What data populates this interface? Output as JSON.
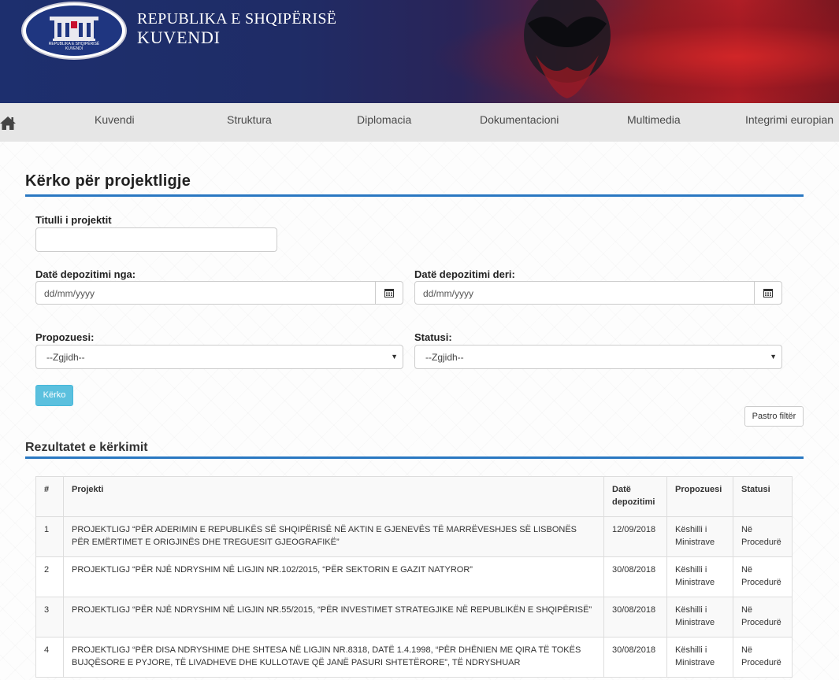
{
  "header": {
    "seal_text_line1": "REPUBLIKA E SHQIPËRISË",
    "seal_text_line2": "KUVENDI",
    "title_line1": "REPUBLIKA E SHQIPËRISË",
    "title_line2": "KUVENDI"
  },
  "nav": {
    "home_icon": "home-icon",
    "items": [
      "Kuvendi",
      "Struktura",
      "Diplomacia",
      "Dokumentacioni",
      "Multimedia",
      "Integrimi europian"
    ]
  },
  "page": {
    "title": "Kërko për projektligje"
  },
  "form": {
    "title_label": "Titulli i projektit",
    "title_value": "",
    "date_from_label": "Datë depozitimi nga:",
    "date_from_placeholder": "dd/mm/yyyy",
    "date_to_label": "Datë depozitimi deri:",
    "date_to_placeholder": "dd/mm/yyyy",
    "proposer_label": "Propozuesi:",
    "proposer_selected": "--Zgjidh--",
    "status_label": "Statusi:",
    "status_selected": "--Zgjidh--",
    "search_button": "Kërko",
    "clear_button": "Pastro filtër"
  },
  "results": {
    "title": "Rezultatet e kërkimit",
    "columns": [
      "#",
      "Projekti",
      "Datë depozitimi",
      "Propozuesi",
      "Statusi"
    ],
    "rows": [
      {
        "num": "1",
        "project": "PROJEKTLIGJ “PËR ADERIMIN E REPUBLIKËS SË SHQIPËRISË NË AKTIN E GJENEVËS TË MARRËVESHJES SË LISBONËS PËR EMËRTIMET E ORIGJINËS DHE TREGUESIT GJEOGRAFIKË”",
        "date": "12/09/2018",
        "proposer": "Këshilli i Ministrave",
        "status": "Në Procedurë"
      },
      {
        "num": "2",
        "project": "PROJEKTLIGJ “PËR NJË NDRYSHIM NË LIGJIN NR.102/2015, “PËR SEKTORIN E GAZIT NATYROR”",
        "date": "30/08/2018",
        "proposer": "Këshilli i Ministrave",
        "status": "Në Procedurë"
      },
      {
        "num": "3",
        "project": "PROJEKTLIGJ “PËR NJË NDRYSHIM NË LIGJIN NR.55/2015, “PËR INVESTIMET STRATEGJIKE NË REPUBLIKËN E SHQIPËRISË”",
        "date": "30/08/2018",
        "proposer": "Këshilli i Ministrave",
        "status": "Në Procedurë"
      },
      {
        "num": "4",
        "project": "PROJEKTLIGJ “PËR DISA NDRYSHIME DHE SHTESA NË LIGJIN NR.8318, DATË 1.4.1998, “PËR DHËNIEN ME QIRA TË TOKËS BUJQËSORE E PYJORE, TË LIVADHEVE DHE KULLOTAVE QË JANË PASURI SHTETËRORE”, TË NDRYSHUAR",
        "date": "30/08/2018",
        "proposer": "Këshilli i Ministrave",
        "status": "Në Procedurë"
      }
    ]
  },
  "colors": {
    "accent_blue": "#2a78c2",
    "button_info": "#5bc0de",
    "nav_bg": "#e6e6e6",
    "banner_blue": "#1d2f6e",
    "banner_red": "#b01e26"
  }
}
